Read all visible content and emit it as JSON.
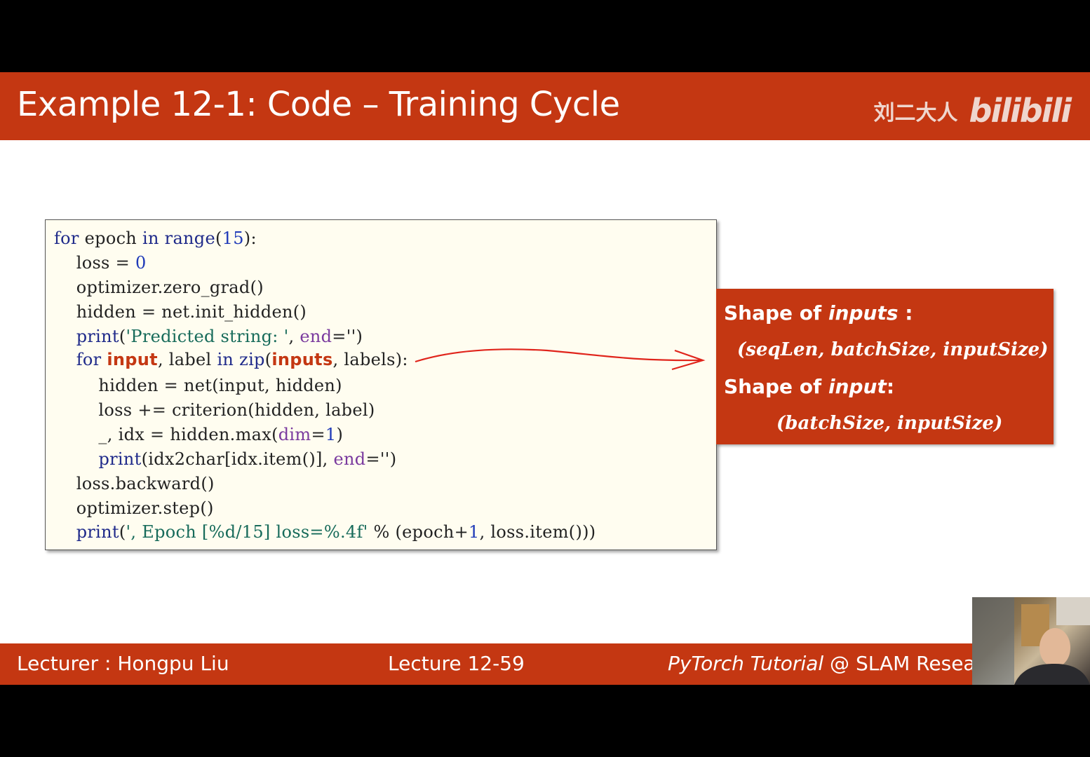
{
  "slide": {
    "title": "Example 12-1: Code – Training Cycle",
    "watermark_text": "刘二大人",
    "watermark_logo": "bilibili"
  },
  "code": {
    "line1": {
      "kw1": "for",
      "t1": " epoch ",
      "kw2": "in",
      "t2": " ",
      "fn": "range",
      "t3": "(",
      "num": "15",
      "t4": "):"
    },
    "line2": {
      "t1": "    loss = ",
      "num": "0"
    },
    "line3": {
      "t1": "    optimizer.zero_grad()"
    },
    "line4": {
      "t1": "    hidden = net.init_hidden()"
    },
    "line5": {
      "fn": "print",
      "t1": "(",
      "str": "'Predicted string: '",
      "t2": ", ",
      "param": "end",
      "t3": "='')"
    },
    "line6": {
      "kw1": "for",
      "hl1": "input",
      "t1": ", label ",
      "kw2": "in",
      "t2": " ",
      "fn": "zip",
      "t3": "(",
      "hl2": "inputs",
      "t4": ", labels):"
    },
    "line7": {
      "t1": "        hidden = net(input, hidden)"
    },
    "line8": {
      "t1": "        loss += criterion(hidden, label)"
    },
    "line9": {
      "t1": "        _, idx = hidden.max(",
      "param": "dim",
      "t2": "=",
      "num": "1",
      "t3": ")"
    },
    "line10": {
      "fn": "print",
      "t1": "(idx2char[idx.item()], ",
      "param": "end",
      "t2": "='')"
    },
    "line11": {
      "t1": "    loss.backward()"
    },
    "line12": {
      "t1": "    optimizer.step()"
    },
    "line13": {
      "fn": "print",
      "t1": "(",
      "str": "', Epoch [%d/15] loss=%.4f'",
      "t2": " % (epoch+",
      "num": "1",
      "t3": ", loss.item()))"
    }
  },
  "annotation": {
    "shape_inputs_prefix": "Shape of ",
    "shape_inputs_var": "inputs",
    "shape_inputs_suffix": " :",
    "inputs_formula": "(seqLen, batchSize, inputSize)",
    "shape_input_prefix": "Shape of ",
    "shape_input_var": "input",
    "shape_input_suffix": ":",
    "input_formula": "(batchSize, inputSize)"
  },
  "footer": {
    "lecturer": "Lecturer : Hongpu Liu",
    "lecture": "Lecture 12-59",
    "tutorial_italic": "PyTorch Tutorial",
    "tutorial_rest": " @ SLAM Resea"
  },
  "colors": {
    "accent": "#c43712",
    "code_bg": "#fffdf0",
    "keyword": "#1f2a8a",
    "string": "#176b5a",
    "param": "#7a3a9e",
    "pen": "#e0241b"
  }
}
